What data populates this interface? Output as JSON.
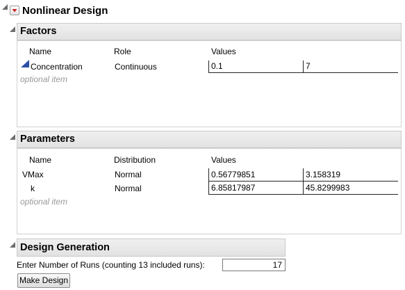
{
  "main_title": "Nonlinear Design",
  "factors": {
    "title": "Factors",
    "columns": [
      "Name",
      "Role",
      "Values"
    ],
    "rows": [
      {
        "name": "Concentration",
        "role": "Continuous",
        "low": "0.1",
        "high": "7"
      }
    ],
    "optional": "optional item"
  },
  "parameters": {
    "title": "Parameters",
    "columns": [
      "Name",
      "Distribution",
      "Values"
    ],
    "rows": [
      {
        "name": "VMax",
        "distribution": "Normal",
        "v1": "0.56779851",
        "v2": "3.158319"
      },
      {
        "name": "k",
        "distribution": "Normal",
        "v1": "6.85817987",
        "v2": "45.8299983"
      }
    ],
    "optional": "optional item"
  },
  "design": {
    "title": "Design Generation",
    "runs_label": "Enter Number of Runs (counting 13 included runs):",
    "runs_value": "17",
    "make_button": "Make Design"
  },
  "colors": {
    "red_menu": "#cc2222",
    "continuous_icon": "#2b4fa8"
  }
}
